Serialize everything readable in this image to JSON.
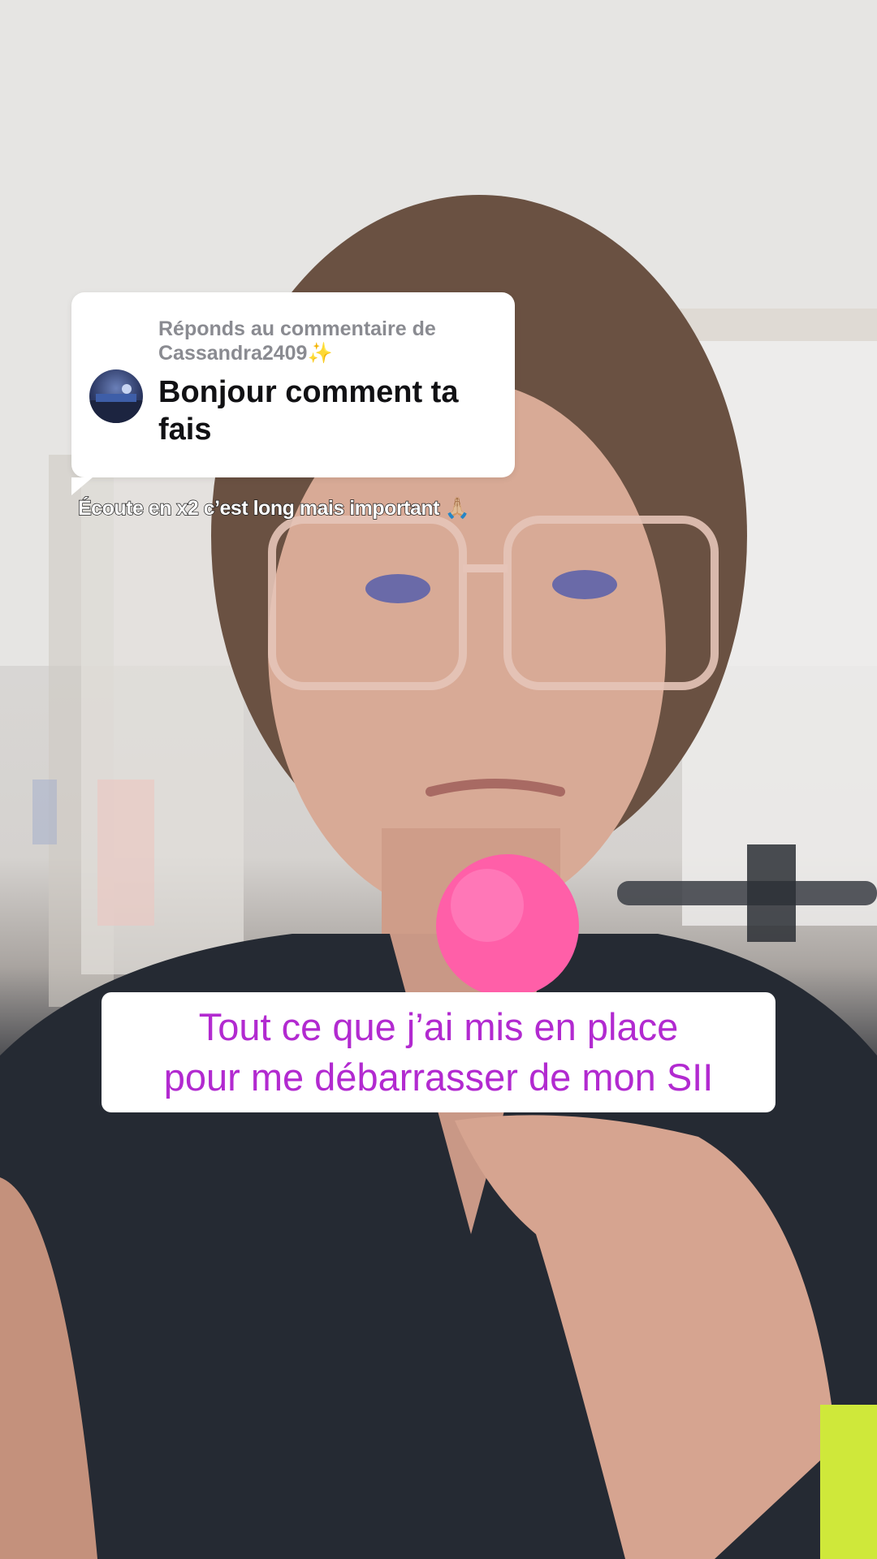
{
  "reply_card": {
    "header_prefix": "Réponds au commentaire de",
    "username": "Cassandra2409",
    "username_emoji": "✨",
    "comment": "Bonjour comment ta fais",
    "avatar_icon": "user-avatar"
  },
  "caption_small": {
    "text": "Écoute en x2 c’est long mais important",
    "emoji": "🙏🏼"
  },
  "caption_main": {
    "line1": "Tout ce que j’ai mis en place",
    "line2": "pour me débarrasser de mon SII"
  },
  "colors": {
    "caption_text": "#b22ad0",
    "card_bg": "#ffffff",
    "header_gray": "#8a8b91",
    "comment_text": "#111114"
  }
}
